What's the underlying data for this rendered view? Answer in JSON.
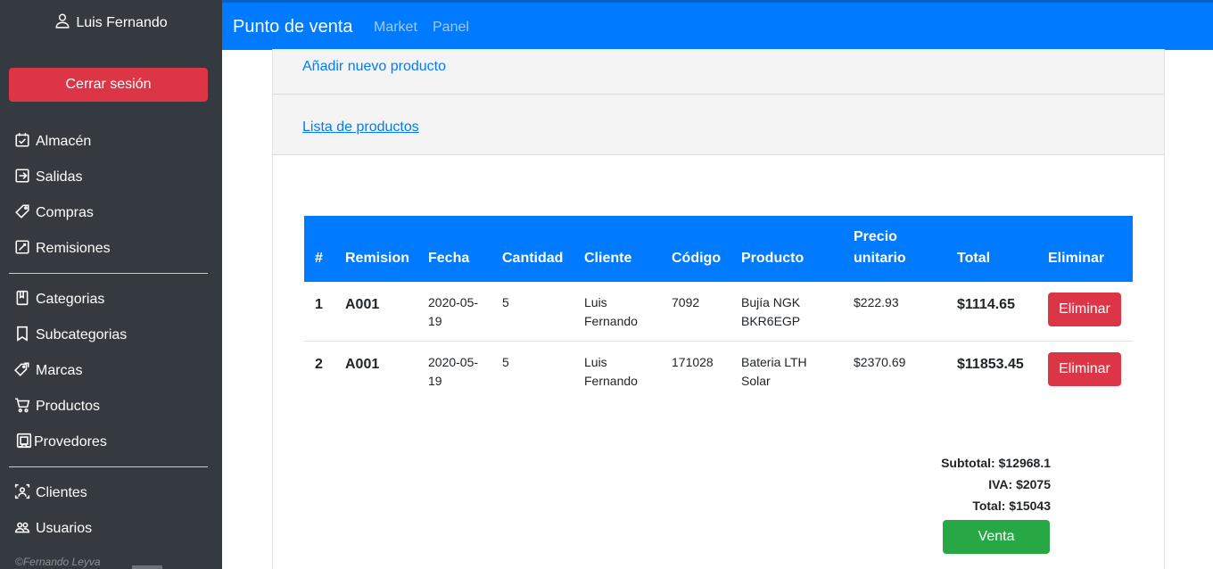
{
  "sidebar": {
    "user_name": "Luis Fernando",
    "logout_label": "Cerrar sesión",
    "items": [
      {
        "label": "Almacén",
        "icon": "calendar-icon"
      },
      {
        "label": "Salidas",
        "icon": "exit-icon"
      },
      {
        "label": "Compras",
        "icon": "tag-icon"
      },
      {
        "label": "Remisiones",
        "icon": "edit-icon"
      },
      {
        "label": "Categorias",
        "icon": "book-icon"
      },
      {
        "label": "Subcategorias",
        "icon": "bookmark-icon"
      },
      {
        "label": "Marcas",
        "icon": "tags-icon"
      },
      {
        "label": "Productos",
        "icon": "cart-icon"
      },
      {
        "label": "Provedores",
        "icon": "contact-icon"
      },
      {
        "label": "Clientes",
        "icon": "person-badge-icon"
      },
      {
        "label": "Usuarios",
        "icon": "people-icon"
      }
    ],
    "footer": "©Fernando Leyva"
  },
  "navbar": {
    "brand": "Punto de venta",
    "links": [
      "Market",
      "Panel"
    ]
  },
  "main": {
    "add_link": "Añadir nuevo producto",
    "list_link": "Lista de productos",
    "table": {
      "headers": [
        "#",
        "Remision",
        "Fecha",
        "Cantidad",
        "Cliente",
        "Código",
        "Producto",
        "Precio unitario",
        "Total",
        "Eliminar"
      ],
      "rows": [
        {
          "num": "1",
          "remision": "A001",
          "fecha": "2020-05-19",
          "cantidad": "5",
          "cliente": "Luis Fernando",
          "codigo": "7092",
          "producto": "Bujía NGK BKR6EGP",
          "precio": "$222.93",
          "total": "$1114.65",
          "action": "Eliminar"
        },
        {
          "num": "2",
          "remision": "A001",
          "fecha": "2020-05-19",
          "cantidad": "5",
          "cliente": "Luis Fernando",
          "codigo": "171028",
          "producto": "Bateria LTH Solar",
          "precio": "$2370.69",
          "total": "$11853.45",
          "action": "Eliminar"
        }
      ]
    },
    "totals": {
      "subtotal": "Subtotal: $12968.1",
      "iva": "IVA: $2075",
      "total": "Total: $15043"
    },
    "venta_label": "Venta"
  },
  "colors": {
    "sidebar_bg": "#343a40",
    "primary": "#007bff",
    "danger": "#dc3545",
    "success": "#28a745"
  }
}
